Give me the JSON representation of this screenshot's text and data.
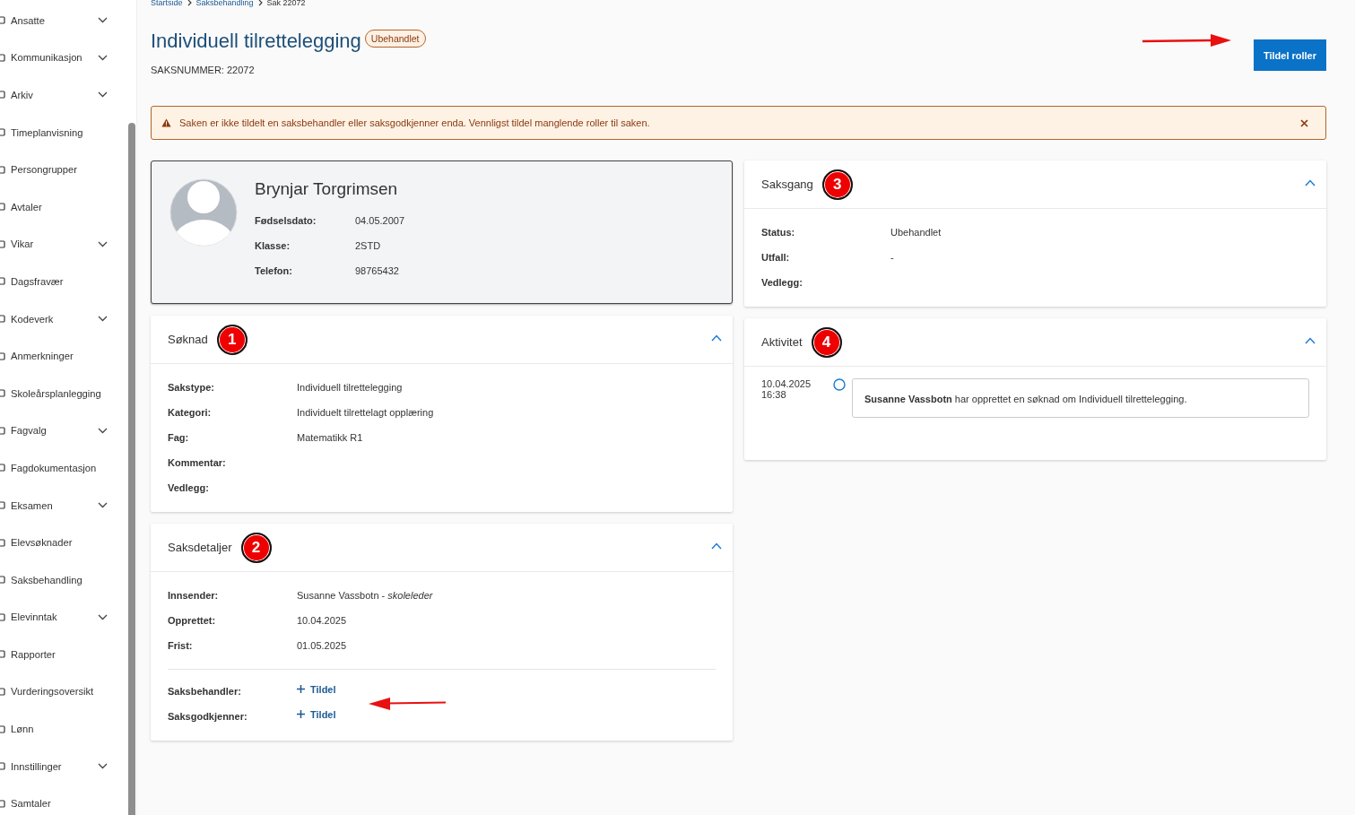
{
  "sidebar": {
    "items": [
      {
        "label": "Ansatte",
        "has_submenu": true
      },
      {
        "label": "Kommunikasjon",
        "has_submenu": true
      },
      {
        "label": "Arkiv",
        "has_submenu": true
      },
      {
        "label": "Timeplanvisning",
        "has_submenu": false
      },
      {
        "label": "Persongrupper",
        "has_submenu": false
      },
      {
        "label": "Avtaler",
        "has_submenu": false
      },
      {
        "label": "Vikar",
        "has_submenu": true
      },
      {
        "label": "Dagsfravær",
        "has_submenu": false
      },
      {
        "label": "Kodeverk",
        "has_submenu": true
      },
      {
        "label": "Anmerkninger",
        "has_submenu": false
      },
      {
        "label": "Skoleårsplanlegging",
        "has_submenu": false
      },
      {
        "label": "Fagvalg",
        "has_submenu": true
      },
      {
        "label": "Fagdokumentasjon",
        "has_submenu": false
      },
      {
        "label": "Eksamen",
        "has_submenu": true
      },
      {
        "label": "Elevsøknader",
        "has_submenu": false
      },
      {
        "label": "Saksbehandling",
        "has_submenu": false
      },
      {
        "label": "Elevinntak",
        "has_submenu": true
      },
      {
        "label": "Rapporter",
        "has_submenu": false
      },
      {
        "label": "Vurderingsoversikt",
        "has_submenu": false
      },
      {
        "label": "Lønn",
        "has_submenu": false
      },
      {
        "label": "Innstillinger",
        "has_submenu": true
      },
      {
        "label": "Samtaler",
        "has_submenu": false
      }
    ]
  },
  "breadcrumb": [
    {
      "label": "Startside",
      "current": false
    },
    {
      "label": "Saksbehandling",
      "current": false
    },
    {
      "label": "Sak 22072",
      "current": true
    }
  ],
  "page": {
    "title": "Individuell tilrettelegging",
    "status_badge": "Ubehandlet",
    "case_number": "SAKSNUMMER: 22072",
    "primary_button": "Tildel roller"
  },
  "alert": {
    "message": "Saken er ikke tildelt en saksbehandler eller saksgodkjenner enda. Vennligst tildel manglende roller til saken."
  },
  "person": {
    "name": "Brynjar Torgrimsen",
    "fields": [
      {
        "label": "Fødselsdato:",
        "value": "04.05.2007"
      },
      {
        "label": "Klasse:",
        "value": "2STD"
      },
      {
        "label": "Telefon:",
        "value": "98765432"
      }
    ]
  },
  "columns": [
    {
      "panels": [
        {
          "kind": "fields",
          "title": "Søknad",
          "marker": "1",
          "expanded": true,
          "fields": [
            {
              "label": "Sakstype:",
              "value": "Individuell tilrettelegging"
            },
            {
              "label": "Kategori:",
              "value": "Individuelt tilrettelagt opplæring"
            },
            {
              "label": "Fag:",
              "value": "Matematikk R1"
            },
            {
              "label": "Kommentar:"
            },
            {
              "label": "Vedlegg:"
            }
          ]
        },
        {
          "kind": "fields",
          "title": "Saksdetaljer",
          "marker": "2",
          "expanded": true,
          "fields": [
            {
              "label": "Innsender:",
              "value": "Susanne Vassbotn - *skoleleder*"
            },
            {
              "label": "Opprettet:",
              "value": "10.04.2025"
            },
            {
              "label": "Frist:",
              "value": "01.05.2025"
            }
          ],
          "assignments": [
            {
              "label": "Saksbehandler:",
              "action": "Tildel"
            },
            {
              "label": "Saksgodkjenner:",
              "action": "Tildel"
            }
          ]
        }
      ]
    },
    {
      "panels": [
        {
          "kind": "fields",
          "title": "Saksgang",
          "marker": "3",
          "expanded": true,
          "fields": [
            {
              "label": "Status:",
              "value": "Ubehandlet"
            },
            {
              "label": "Utfall:",
              "value": "-"
            },
            {
              "label": "Vedlegg:"
            }
          ]
        },
        {
          "kind": "timeline",
          "title": "Aktivitet",
          "marker": "4",
          "expanded": true,
          "entries": [
            {
              "date": "10.04.2025",
              "time": "16:38",
              "text": "**Susanne Vassbotn** har opprettet en søknad om Individuell tilrettelegging."
            }
          ]
        }
      ]
    }
  ]
}
